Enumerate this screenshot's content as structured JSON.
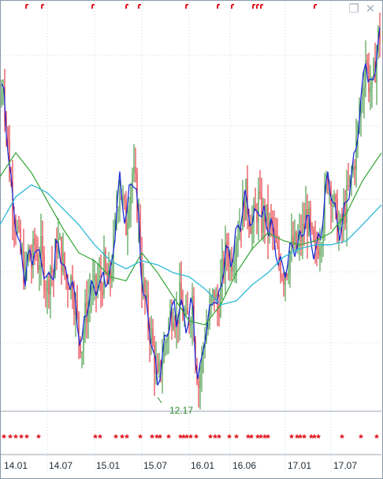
{
  "colors": {
    "background": "#ffffff",
    "grid": "#cfd6dc",
    "panel_border": "#9aa6b2",
    "up_candle": "#2e8b2e",
    "down_candle": "#e01b24",
    "ma_fast": "#1d2ed8",
    "ma_mid": "#2fa52f",
    "ma_slow": "#2bb8d6",
    "marker": "#e01b24",
    "low_label": "#2e8b2e"
  },
  "window_buttons": {
    "restore_icon": "restore-icon",
    "close_icon": "close-icon"
  },
  "low_price_label": "12.17",
  "chart_data": {
    "type": "candlestick",
    "x_tick_labels": [
      "14.01",
      "14.07",
      "15.01",
      "15.07",
      "16.01",
      "16.06",
      "17.01",
      "17.07"
    ],
    "price_series": [
      {
        "i": 0,
        "v": 19.6
      },
      {
        "i": 4,
        "v": 20.2
      },
      {
        "i": 8,
        "v": 19.1
      },
      {
        "i": 12,
        "v": 18.0
      },
      {
        "i": 16,
        "v": 17.2
      },
      {
        "i": 20,
        "v": 16.7
      },
      {
        "i": 24,
        "v": 16.1
      },
      {
        "i": 28,
        "v": 15.7
      },
      {
        "i": 32,
        "v": 15.3
      },
      {
        "i": 36,
        "v": 15.9
      },
      {
        "i": 40,
        "v": 15.6
      },
      {
        "i": 44,
        "v": 16.1
      },
      {
        "i": 48,
        "v": 15.7
      },
      {
        "i": 52,
        "v": 15.9
      },
      {
        "i": 56,
        "v": 15.4
      },
      {
        "i": 60,
        "v": 15.0
      },
      {
        "i": 64,
        "v": 15.6
      },
      {
        "i": 68,
        "v": 15.3
      },
      {
        "i": 72,
        "v": 16.2
      },
      {
        "i": 76,
        "v": 16.0
      },
      {
        "i": 80,
        "v": 15.6
      },
      {
        "i": 84,
        "v": 15.2
      },
      {
        "i": 88,
        "v": 15.3
      },
      {
        "i": 92,
        "v": 15.1
      },
      {
        "i": 96,
        "v": 14.5
      },
      {
        "i": 100,
        "v": 13.9
      },
      {
        "i": 104,
        "v": 13.6
      },
      {
        "i": 108,
        "v": 14.3
      },
      {
        "i": 112,
        "v": 14.7
      },
      {
        "i": 116,
        "v": 15.0
      },
      {
        "i": 120,
        "v": 14.9
      },
      {
        "i": 124,
        "v": 15.2
      },
      {
        "i": 128,
        "v": 15.0
      },
      {
        "i": 132,
        "v": 15.5
      },
      {
        "i": 136,
        "v": 15.1
      },
      {
        "i": 140,
        "v": 15.3
      },
      {
        "i": 144,
        "v": 16.0
      },
      {
        "i": 148,
        "v": 17.0
      },
      {
        "i": 152,
        "v": 17.7
      },
      {
        "i": 156,
        "v": 17.1
      },
      {
        "i": 160,
        "v": 16.6
      },
      {
        "i": 164,
        "v": 17.4
      },
      {
        "i": 168,
        "v": 17.9
      },
      {
        "i": 172,
        "v": 17.5
      },
      {
        "i": 176,
        "v": 16.7
      },
      {
        "i": 180,
        "v": 15.2
      },
      {
        "i": 184,
        "v": 14.7
      },
      {
        "i": 188,
        "v": 14.2
      },
      {
        "i": 192,
        "v": 13.8
      },
      {
        "i": 196,
        "v": 13.2
      },
      {
        "i": 200,
        "v": 12.6
      },
      {
        "i": 204,
        "v": 13.1
      },
      {
        "i": 208,
        "v": 13.5
      },
      {
        "i": 212,
        "v": 13.9
      },
      {
        "i": 216,
        "v": 14.3
      },
      {
        "i": 220,
        "v": 14.6
      },
      {
        "i": 224,
        "v": 14.2
      },
      {
        "i": 228,
        "v": 14.7
      },
      {
        "i": 232,
        "v": 14.4
      },
      {
        "i": 236,
        "v": 14.1
      },
      {
        "i": 240,
        "v": 14.3
      },
      {
        "i": 244,
        "v": 14.8
      },
      {
        "i": 248,
        "v": 13.4
      },
      {
        "i": 252,
        "v": 12.6
      },
      {
        "i": 256,
        "v": 13.2
      },
      {
        "i": 260,
        "v": 13.9
      },
      {
        "i": 264,
        "v": 14.1
      },
      {
        "i": 268,
        "v": 14.6
      },
      {
        "i": 272,
        "v": 14.9
      },
      {
        "i": 276,
        "v": 14.4
      },
      {
        "i": 280,
        "v": 15.1
      },
      {
        "i": 284,
        "v": 15.6
      },
      {
        "i": 288,
        "v": 16.0
      },
      {
        "i": 292,
        "v": 15.7
      },
      {
        "i": 296,
        "v": 15.9
      },
      {
        "i": 300,
        "v": 16.4
      },
      {
        "i": 304,
        "v": 16.6
      },
      {
        "i": 308,
        "v": 17.0
      },
      {
        "i": 312,
        "v": 17.3
      },
      {
        "i": 316,
        "v": 16.9
      },
      {
        "i": 320,
        "v": 16.6
      },
      {
        "i": 324,
        "v": 16.8
      },
      {
        "i": 328,
        "v": 17.2
      },
      {
        "i": 332,
        "v": 16.7
      },
      {
        "i": 336,
        "v": 16.9
      },
      {
        "i": 340,
        "v": 16.5
      },
      {
        "i": 344,
        "v": 16.6
      },
      {
        "i": 348,
        "v": 16.2
      },
      {
        "i": 352,
        "v": 15.8
      },
      {
        "i": 356,
        "v": 15.6
      },
      {
        "i": 360,
        "v": 15.4
      },
      {
        "i": 364,
        "v": 15.6
      },
      {
        "i": 368,
        "v": 15.9
      },
      {
        "i": 372,
        "v": 16.1
      },
      {
        "i": 376,
        "v": 16.0
      },
      {
        "i": 380,
        "v": 16.2
      },
      {
        "i": 384,
        "v": 16.4
      },
      {
        "i": 388,
        "v": 16.8
      },
      {
        "i": 392,
        "v": 16.6
      },
      {
        "i": 396,
        "v": 16.1
      },
      {
        "i": 400,
        "v": 15.8
      },
      {
        "i": 404,
        "v": 16.2
      },
      {
        "i": 408,
        "v": 16.5
      },
      {
        "i": 412,
        "v": 17.2
      },
      {
        "i": 416,
        "v": 17.8
      },
      {
        "i": 420,
        "v": 17.5
      },
      {
        "i": 424,
        "v": 17.0
      },
      {
        "i": 428,
        "v": 16.6
      },
      {
        "i": 432,
        "v": 16.4
      },
      {
        "i": 436,
        "v": 16.8
      },
      {
        "i": 440,
        "v": 17.2
      },
      {
        "i": 444,
        "v": 17.6
      },
      {
        "i": 448,
        "v": 18.0
      },
      {
        "i": 452,
        "v": 18.6
      },
      {
        "i": 456,
        "v": 19.3
      },
      {
        "i": 460,
        "v": 20.0
      },
      {
        "i": 464,
        "v": 20.8
      },
      {
        "i": 468,
        "v": 20.2
      },
      {
        "i": 472,
        "v": 19.9
      },
      {
        "i": 476,
        "v": 20.6
      },
      {
        "i": 480,
        "v": 21.3
      }
    ],
    "ma_slow_series": [
      {
        "i": 0,
        "v": 16.6
      },
      {
        "i": 20,
        "v": 17.3
      },
      {
        "i": 40,
        "v": 17.6
      },
      {
        "i": 60,
        "v": 17.4
      },
      {
        "i": 80,
        "v": 17.0
      },
      {
        "i": 100,
        "v": 16.6
      },
      {
        "i": 120,
        "v": 16.1
      },
      {
        "i": 140,
        "v": 15.7
      },
      {
        "i": 160,
        "v": 15.5
      },
      {
        "i": 180,
        "v": 15.7
      },
      {
        "i": 200,
        "v": 15.6
      },
      {
        "i": 220,
        "v": 15.4
      },
      {
        "i": 240,
        "v": 15.3
      },
      {
        "i": 260,
        "v": 15.0
      },
      {
        "i": 280,
        "v": 14.6
      },
      {
        "i": 300,
        "v": 14.7
      },
      {
        "i": 320,
        "v": 15.1
      },
      {
        "i": 340,
        "v": 15.4
      },
      {
        "i": 360,
        "v": 15.8
      },
      {
        "i": 380,
        "v": 16.0
      },
      {
        "i": 400,
        "v": 16.1
      },
      {
        "i": 420,
        "v": 16.1
      },
      {
        "i": 440,
        "v": 16.2
      },
      {
        "i": 460,
        "v": 16.6
      },
      {
        "i": 484,
        "v": 17.1
      }
    ],
    "ma_mid_series": [
      {
        "i": 0,
        "v": 17.8
      },
      {
        "i": 20,
        "v": 18.4
      },
      {
        "i": 40,
        "v": 17.9
      },
      {
        "i": 60,
        "v": 17.2
      },
      {
        "i": 80,
        "v": 16.5
      },
      {
        "i": 100,
        "v": 15.9
      },
      {
        "i": 120,
        "v": 15.7
      },
      {
        "i": 140,
        "v": 15.3
      },
      {
        "i": 160,
        "v": 15.2
      },
      {
        "i": 180,
        "v": 15.9
      },
      {
        "i": 200,
        "v": 15.4
      },
      {
        "i": 220,
        "v": 14.8
      },
      {
        "i": 240,
        "v": 14.2
      },
      {
        "i": 260,
        "v": 14.1
      },
      {
        "i": 280,
        "v": 14.6
      },
      {
        "i": 300,
        "v": 15.4
      },
      {
        "i": 320,
        "v": 16.0
      },
      {
        "i": 340,
        "v": 16.4
      },
      {
        "i": 360,
        "v": 16.2
      },
      {
        "i": 380,
        "v": 16.1
      },
      {
        "i": 400,
        "v": 16.2
      },
      {
        "i": 420,
        "v": 16.4
      },
      {
        "i": 440,
        "v": 16.9
      },
      {
        "i": 460,
        "v": 17.7
      },
      {
        "i": 484,
        "v": 18.4
      }
    ],
    "ylim": [
      12.0,
      22.0
    ],
    "marker_rows": {
      "top_ticks_x": [
        35,
        55,
        119,
        162,
        178,
        238,
        278,
        296,
        323,
        328,
        333,
        401
      ],
      "bottom_stars_x": [
        5,
        13,
        20,
        27,
        34,
        49,
        121,
        127,
        147,
        155,
        161,
        178,
        193,
        199,
        203,
        214,
        229,
        233,
        237,
        242,
        249,
        267,
        273,
        278,
        291,
        300,
        315,
        319,
        327,
        331,
        336,
        340,
        370,
        377,
        381,
        386,
        395,
        399,
        404,
        434,
        458,
        478
      ]
    }
  }
}
